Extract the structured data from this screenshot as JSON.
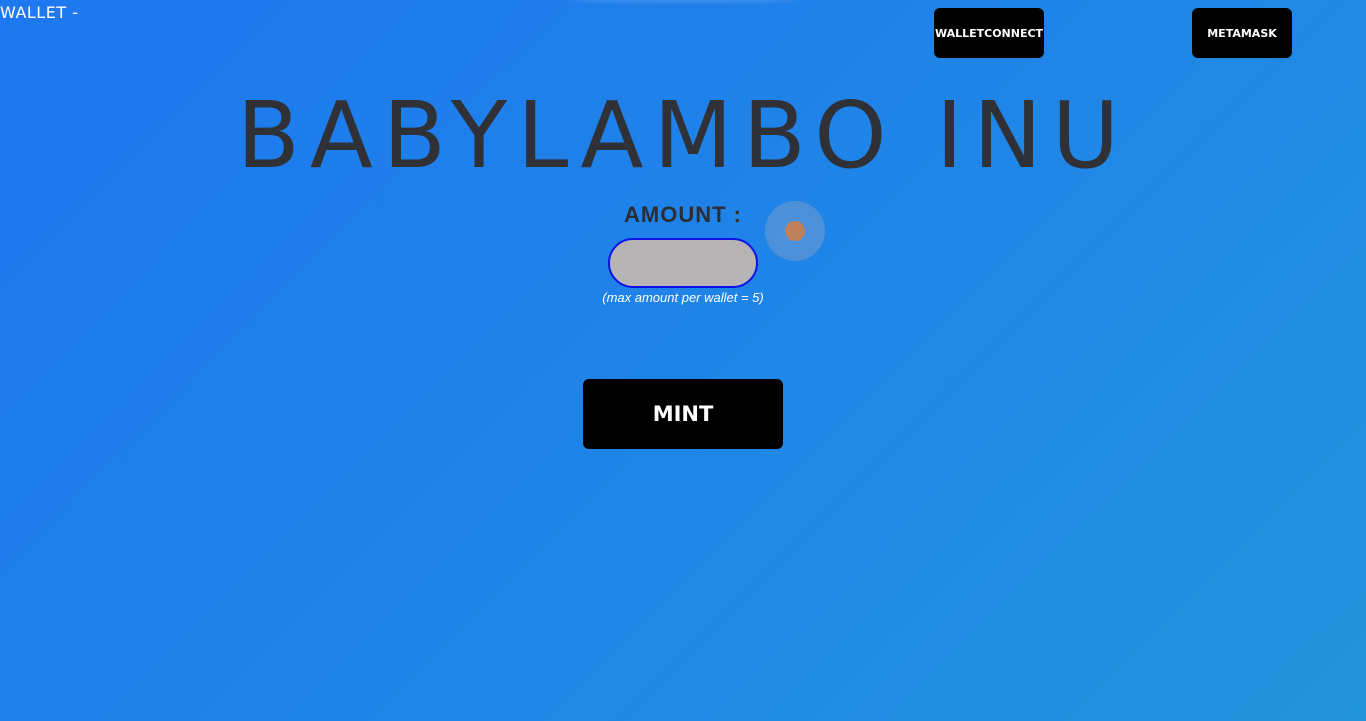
{
  "header": {
    "wallet_status": "WALLET -",
    "walletconnect_label": "WALLETCONNECT",
    "metamask_label": "METAMASK"
  },
  "main": {
    "title": "BABYLAMBO INU",
    "amount_label": "AMOUNT :",
    "amount_value": "",
    "amount_placeholder": "",
    "max_note": "(max amount per wallet = 5)",
    "mint_label": "MINT"
  },
  "colors": {
    "background_start": "#1e78ef",
    "background_end": "#2294dc",
    "title": "#2f3136",
    "button": "#000000",
    "input_fill": "#b7b4b5",
    "input_border": "#1010e8"
  },
  "icons": {
    "cursor": "cursor-indicator-icon"
  }
}
